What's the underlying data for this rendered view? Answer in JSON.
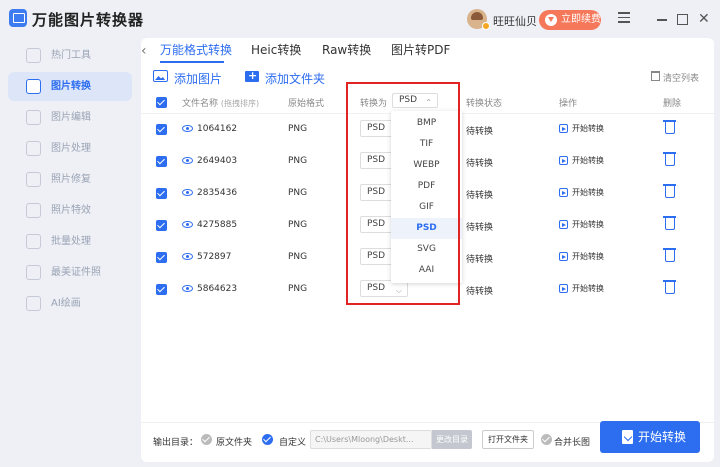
{
  "app": {
    "title": "万能图片转换器"
  },
  "user": {
    "name": "旺旺仙贝",
    "renew_label": "立即续费"
  },
  "sidebar": {
    "items": [
      {
        "label": "热门工具",
        "active": false
      },
      {
        "label": "图片转换",
        "active": true
      },
      {
        "label": "图片编辑",
        "active": false
      },
      {
        "label": "图片处理",
        "active": false
      },
      {
        "label": "照片修复",
        "active": false
      },
      {
        "label": "照片特效",
        "active": false
      },
      {
        "label": "批量处理",
        "active": false
      },
      {
        "label": "最美证件照",
        "active": false
      },
      {
        "label": "AI绘画",
        "active": false
      }
    ]
  },
  "tabs": [
    {
      "label": "万能格式转换",
      "active": true
    },
    {
      "label": "Heic转换",
      "active": false
    },
    {
      "label": "Raw转换",
      "active": false
    },
    {
      "label": "图片转PDF",
      "active": false
    }
  ],
  "toolbar": {
    "add_image": "添加图片",
    "add_folder": "添加文件夹",
    "clear_list": "清空列表"
  },
  "table": {
    "headers": {
      "filename": "文件名称",
      "filename_sub": "(拖拽排序)",
      "format": "原始格式",
      "convert_to": "转换为",
      "convert_to_value": "PSD",
      "status": "转换状态",
      "action": "操作",
      "delete": "删除"
    },
    "rows": [
      {
        "name": "1064162",
        "format": "PNG",
        "target": "PSD",
        "status": "待转换",
        "action": "开始转换"
      },
      {
        "name": "2649403",
        "format": "PNG",
        "target": "PSD",
        "status": "待转换",
        "action": "开始转换"
      },
      {
        "name": "2835436",
        "format": "PNG",
        "target": "PSD",
        "status": "待转换",
        "action": "开始转换"
      },
      {
        "name": "4275885",
        "format": "PNG",
        "target": "PSD",
        "status": "待转换",
        "action": "开始转换"
      },
      {
        "name": "572897",
        "format": "PNG",
        "target": "PSD",
        "status": "待转换",
        "action": "开始转换"
      },
      {
        "name": "5864623",
        "format": "PNG",
        "target": "PSD",
        "status": "待转换",
        "action": "开始转换"
      }
    ]
  },
  "dropdown": {
    "options": [
      "BMP",
      "TIF",
      "WEBP",
      "PDF",
      "GIF",
      "PSD",
      "SVG",
      "AAI"
    ],
    "selected": "PSD"
  },
  "footer": {
    "output_label": "输出目录：",
    "original_folder": "原文件夹",
    "custom": "自定义",
    "path": "C:\\Users\\Mloong\\Deskt...",
    "change_dir": "更改目录",
    "open_folder": "打开文件夹",
    "merge": "合并长图",
    "start": "开始转换"
  },
  "colors": {
    "accent": "#2d6df0",
    "highlight_box": "#e02424",
    "renew": "#f5785a"
  }
}
